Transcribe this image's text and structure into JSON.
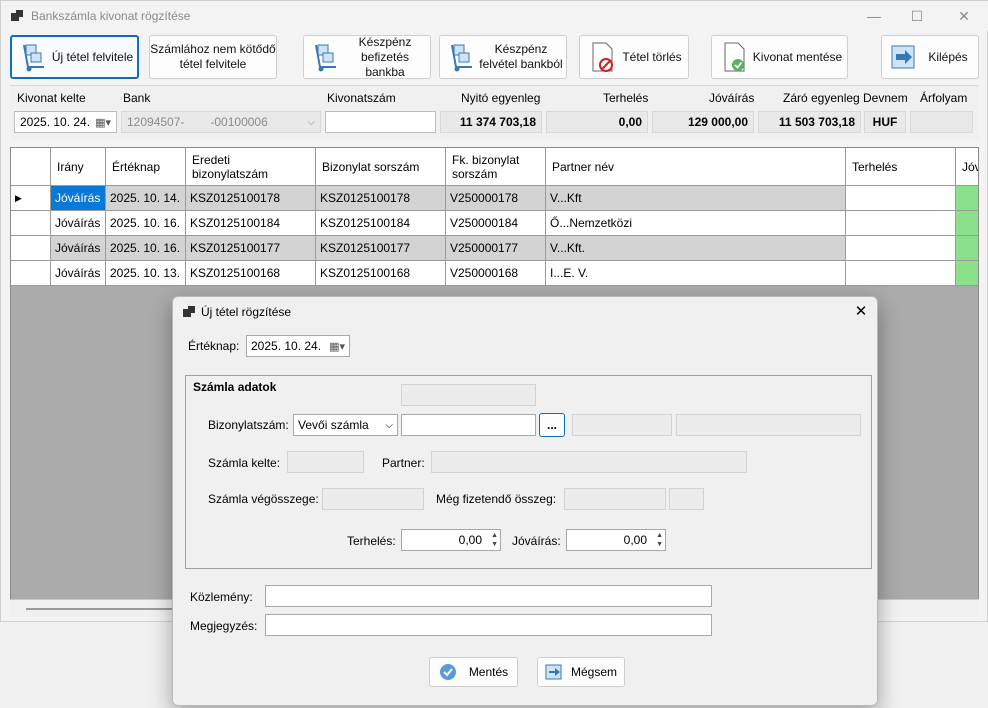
{
  "window": {
    "title": "Bankszámla kivonat rögzítése",
    "minimize": "—",
    "maximize": "☐",
    "close": "✕"
  },
  "toolbar": {
    "new_item": "Új tétel felvitele",
    "unrelated_item": "Számlához nem kötődő tétel felvitele",
    "cash_deposit": "Készpénz befizetés bankba",
    "cash_withdrawal": "Készpénz felvétel bankból",
    "delete_item": "Tétel törlés",
    "save_statement": "Kivonat mentése",
    "exit": "Kilépés"
  },
  "header": {
    "labels": {
      "date": "Kivonat kelte",
      "bank": "Bank",
      "statement_no": "Kivonatszám",
      "opening": "Nyitó egyenleg",
      "debit": "Terhelés",
      "credit": "Jóváírás",
      "closing": "Záró egyenleg",
      "currency": "Devnem",
      "rate": "Árfolyam"
    },
    "values": {
      "date": "2025. 10. 24.",
      "bank_part1": "12094507-",
      "bank_part2": "-00100006",
      "statement_no": "",
      "opening": "11 374 703,18",
      "debit": "0,00",
      "credit": "129 000,00",
      "closing": "11 503 703,18",
      "currency": "HUF",
      "rate": ""
    }
  },
  "grid": {
    "columns": [
      "Irány",
      "Értéknap",
      "Eredeti bizonylatszám",
      "Bizonylat sorszám",
      "Fk. bizonylat sorszám",
      "Partner név",
      "Terhelés",
      "Jóv"
    ],
    "rows": [
      {
        "dir": "Jóváírás",
        "date": "2025. 10. 14.",
        "orig": "KSZ0125100178",
        "doc": "KSZ0125100178",
        "fk": "V250000178",
        "partner": "V...Kft",
        "debit": ""
      },
      {
        "dir": "Jóváírás",
        "date": "2025. 10. 16.",
        "orig": "KSZ0125100184",
        "doc": "KSZ0125100184",
        "fk": "V250000184",
        "partner": "Ő...Nemzetközi",
        "debit": ""
      },
      {
        "dir": "Jóváírás",
        "date": "2025. 10. 16.",
        "orig": "KSZ0125100177",
        "doc": "KSZ0125100177",
        "fk": "V250000177",
        "partner": "V...Kft.",
        "debit": ""
      },
      {
        "dir": "Jóváírás",
        "date": "2025. 10. 13.",
        "orig": "KSZ0125100168",
        "doc": "KSZ0125100168",
        "fk": "V250000168",
        "partner": "I...E. V.",
        "debit": ""
      }
    ]
  },
  "dialog": {
    "title": "Új tétel rögzítése",
    "close": "✕",
    "value_date_label": "Értéknap:",
    "value_date": "2025. 10. 24.",
    "group_title": "Számla adatok",
    "doc_no_label": "Bizonylatszám:",
    "doc_type": "Vevői számla",
    "browse": "...",
    "invoice_date_label": "Számla kelte:",
    "partner_label": "Partner:",
    "invoice_total_label": "Számla végösszege:",
    "remaining_label": "Még fizetendő összeg:",
    "debit_label": "Terhelés:",
    "debit_value": "0,00",
    "credit_label": "Jóváírás:",
    "credit_value": "0,00",
    "notice_label": "Közlemény:",
    "comment_label": "Megjegyzés:",
    "save": "Mentés",
    "cancel": "Mégsem"
  },
  "colors": {
    "accent": "#0a78d7",
    "credit_cell": "#8be08b"
  }
}
